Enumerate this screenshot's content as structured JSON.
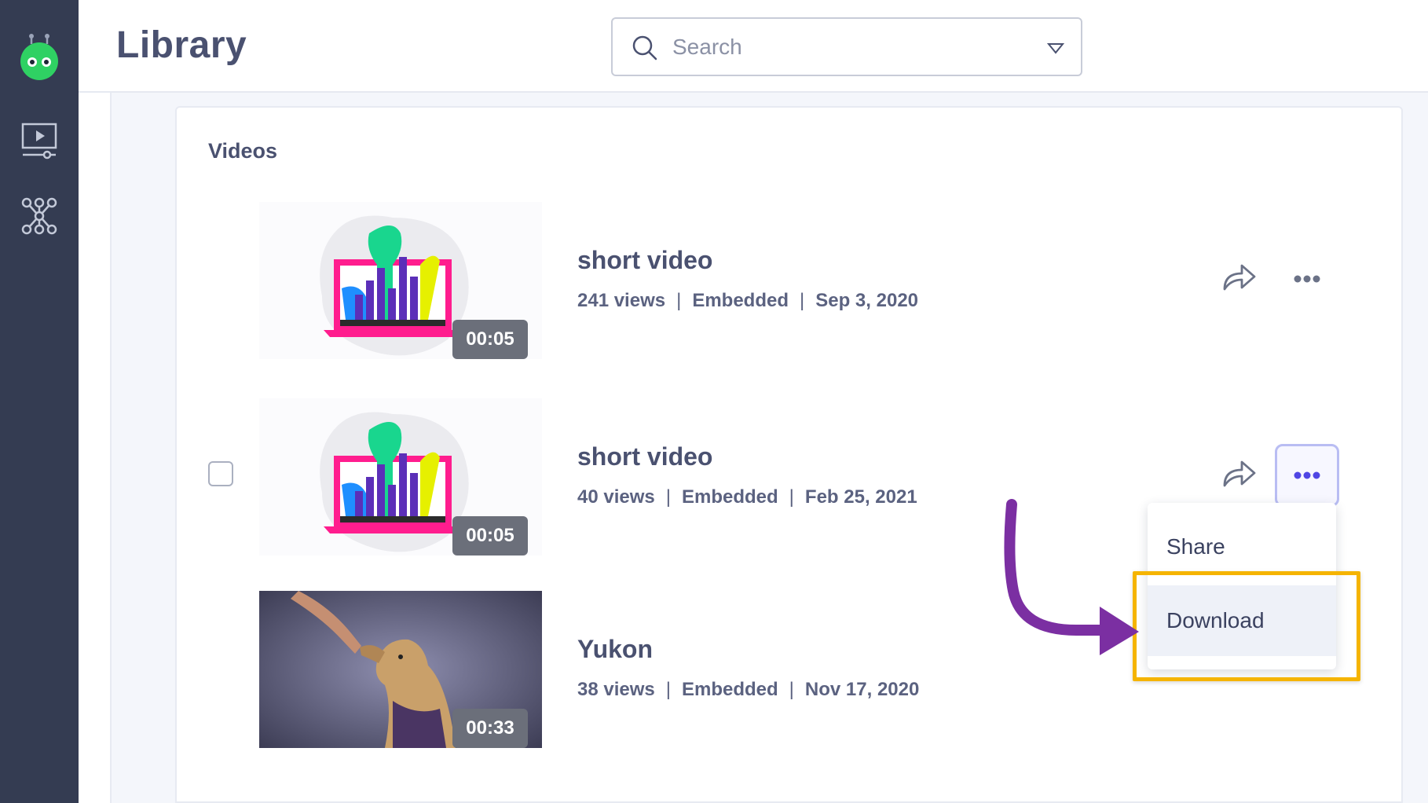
{
  "header": {
    "title": "Library",
    "search_placeholder": "Search"
  },
  "library": {
    "section_title": "Videos",
    "videos": [
      {
        "title": "short video",
        "views": "241 views",
        "type": "Embedded",
        "date": "Sep 3, 2020",
        "duration": "00:05"
      },
      {
        "title": "short video",
        "views": "40 views",
        "type": "Embedded",
        "date": "Feb 25, 2021",
        "duration": "00:05"
      },
      {
        "title": "Yukon",
        "views": "38 views",
        "type": "Embedded",
        "date": "Nov 17, 2020",
        "duration": "00:33"
      }
    ]
  },
  "menu": {
    "items": [
      "Share",
      "Download"
    ]
  },
  "colors": {
    "sidebar": "#343c52",
    "accent": "#5046e4",
    "highlight": "#f5b400",
    "arrow": "#7b2fa2"
  }
}
